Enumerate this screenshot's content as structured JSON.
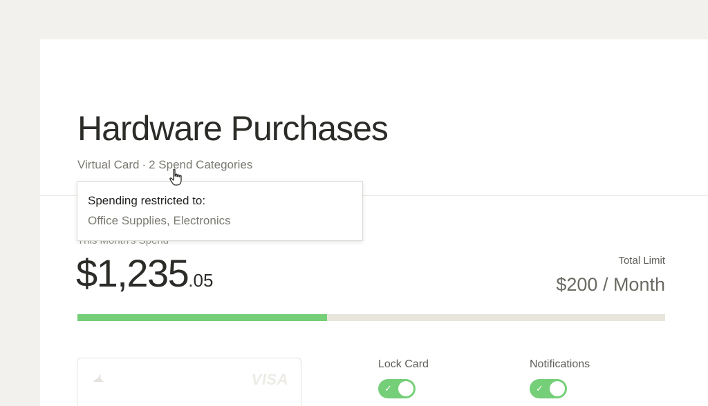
{
  "header": {
    "title": "Hardware Purchases",
    "card_type": "Virtual Card",
    "separator": "·",
    "categories_link": "2 Spend Categories"
  },
  "tooltip": {
    "heading": "Spending restricted to:",
    "categories": "Office Supplies, Electronics"
  },
  "spend": {
    "label": "This Month's Spend",
    "amount_whole": "$1,235",
    "amount_cents": ".05",
    "progress_fraction": 0.425
  },
  "limit": {
    "label": "Total Limit",
    "value": "$200 / Month"
  },
  "card": {
    "brand": "VISA"
  },
  "controls": {
    "lock_label": "Lock Card",
    "lock_on": true,
    "notifications_label": "Notifications",
    "notifications_on": true
  },
  "colors": {
    "accent_green": "#74cf78",
    "track": "#e8e6dc",
    "background": "#f3f1ed"
  },
  "icons": {
    "cursor": "hand-pointer-icon",
    "check": "check-icon",
    "card_logo": "card-logo-icon"
  }
}
